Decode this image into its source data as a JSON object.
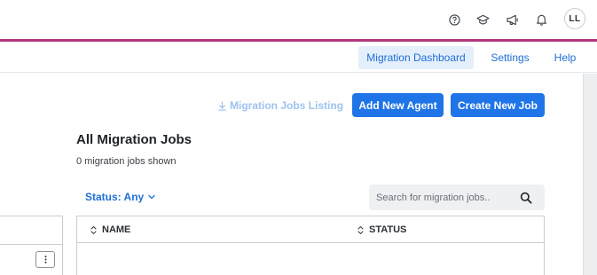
{
  "header": {
    "icons": [
      "help-circle-icon",
      "graduation-cap-icon",
      "megaphone-icon",
      "bell-icon"
    ],
    "avatar_initials": "LL",
    "accent_color": "#b1377b"
  },
  "nav": {
    "items": [
      {
        "label": "Migration Dashboard",
        "active": true
      },
      {
        "label": "Settings",
        "active": false
      },
      {
        "label": "Help",
        "active": false
      }
    ]
  },
  "toolbar": {
    "listing_label": "Migration Jobs Listing",
    "add_agent_label": "Add New Agent",
    "create_job_label": "Create New Job",
    "primary_color": "#1f74e8"
  },
  "main": {
    "title": "All Migration Jobs",
    "count_text": "0 migration jobs shown",
    "status_filter_label": "Status: Any",
    "search_placeholder": "Search for migration jobs..",
    "search_value": ""
  },
  "table": {
    "columns": [
      "NAME",
      "STATUS"
    ],
    "rows": []
  }
}
